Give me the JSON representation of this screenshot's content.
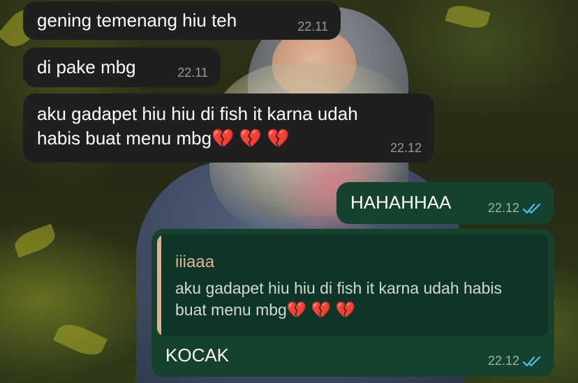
{
  "messages": [
    {
      "direction": "incoming",
      "text": "gening temenang hiu teh",
      "time": "22.11"
    },
    {
      "direction": "incoming",
      "text": "di pake mbg",
      "time": "22.11"
    },
    {
      "direction": "incoming",
      "text": "aku gadapet hiu hiu di fish it karna udah\nhabis buat menu mbg💔 💔 💔",
      "time": "22.12"
    },
    {
      "direction": "outgoing",
      "text": "HAHAHHAA",
      "time": "22.12",
      "status": "read"
    },
    {
      "direction": "outgoing",
      "text": "KOCAK",
      "time": "22.12",
      "status": "read",
      "reply_to": {
        "author": "iiiaaa",
        "text": "aku gadapet hiu hiu di fish it karna udah habis\nbuat menu mbg💔 💔 💔"
      }
    }
  ],
  "colors": {
    "incoming_bubble": "#1f1f1f",
    "outgoing_bubble": "#15412f",
    "quote_accent": "#d9b596",
    "read_ticks": "#53bdeb"
  },
  "icons": {
    "read_receipt": "double-check-icon"
  }
}
